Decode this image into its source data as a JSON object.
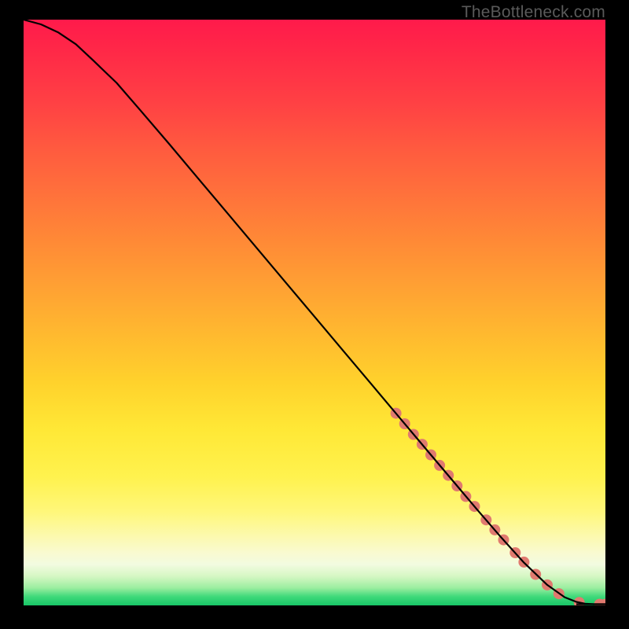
{
  "watermark": "TheBottleneck.com",
  "chart_data": {
    "type": "line",
    "title": "",
    "xlabel": "",
    "ylabel": "",
    "xlim": [
      0,
      100
    ],
    "ylim": [
      0,
      100
    ],
    "grid": false,
    "legend": false,
    "background_gradient": {
      "orientation": "vertical",
      "stops": [
        {
          "pos": 0.0,
          "color": "#ff1a4b"
        },
        {
          "pos": 0.3,
          "color": "#ff723b"
        },
        {
          "pos": 0.6,
          "color": "#ffd22c"
        },
        {
          "pos": 0.85,
          "color": "#fcf9ac"
        },
        {
          "pos": 0.97,
          "color": "#9ceea0"
        },
        {
          "pos": 1.0,
          "color": "#18c667"
        }
      ]
    },
    "series": [
      {
        "name": "curve",
        "kind": "line",
        "color": "#000000",
        "x": [
          0,
          3,
          6,
          9,
          12,
          16,
          20,
          25,
          30,
          35,
          40,
          45,
          50,
          55,
          60,
          65,
          70,
          74,
          78,
          82,
          86,
          90,
          93,
          95,
          96.5,
          98,
          100
        ],
        "y": [
          100,
          99.2,
          97.8,
          95.8,
          93.0,
          89.2,
          84.6,
          78.8,
          72.9,
          67.0,
          61.1,
          55.2,
          49.3,
          43.4,
          37.5,
          31.6,
          25.7,
          21.0,
          16.3,
          11.7,
          7.3,
          3.5,
          1.4,
          0.6,
          0.3,
          0.2,
          0.2
        ]
      },
      {
        "name": "highlight-dots",
        "kind": "scatter",
        "color": "#e07a6f",
        "radius_px": 7,
        "x": [
          64,
          65.5,
          67,
          68.5,
          70,
          71.5,
          73,
          74.5,
          76,
          77.5,
          79.5,
          81,
          82.5,
          84.5,
          86,
          88,
          90,
          92,
          95.5,
          99,
          100
        ],
        "y": [
          32.8,
          31.0,
          29.2,
          27.5,
          25.7,
          23.9,
          22.2,
          20.4,
          18.6,
          16.9,
          14.6,
          12.9,
          11.2,
          9.0,
          7.4,
          5.3,
          3.5,
          2.0,
          0.5,
          0.2,
          0.2
        ]
      }
    ]
  }
}
